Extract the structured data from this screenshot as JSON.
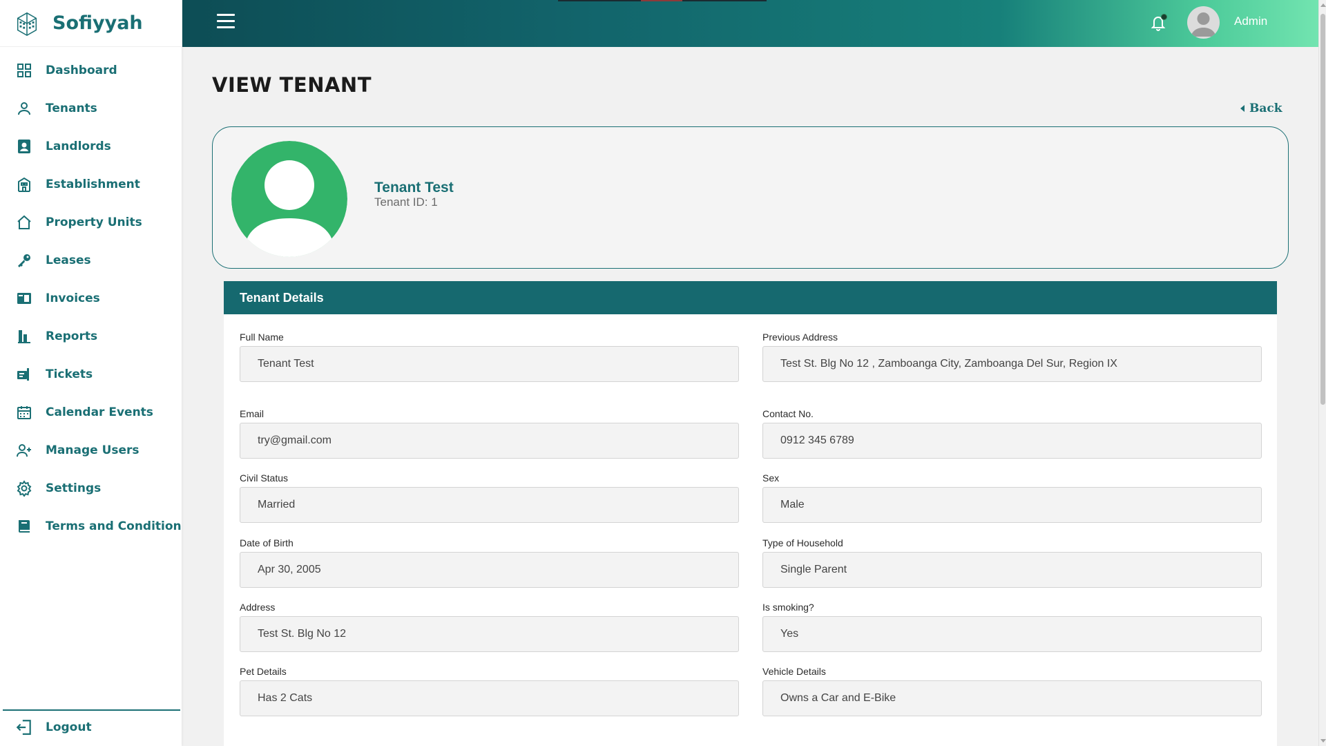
{
  "app": {
    "name": "Sofiyyah"
  },
  "sidebar": {
    "items": [
      {
        "label": "Dashboard",
        "icon": "dashboard-grid-icon"
      },
      {
        "label": "Tenants",
        "icon": "user-outline-icon"
      },
      {
        "label": "Landlords",
        "icon": "id-badge-icon"
      },
      {
        "label": "Establishment",
        "icon": "building-icon"
      },
      {
        "label": "Property Units",
        "icon": "home-icon"
      },
      {
        "label": "Leases",
        "icon": "key-icon"
      },
      {
        "label": "Invoices",
        "icon": "invoice-icon"
      },
      {
        "label": "Reports",
        "icon": "bar-chart-icon"
      },
      {
        "label": "Tickets",
        "icon": "ticket-icon"
      },
      {
        "label": "Calendar Events",
        "icon": "calendar-icon"
      },
      {
        "label": "Manage Users",
        "icon": "user-plus-icon"
      },
      {
        "label": "Settings",
        "icon": "gear-icon"
      },
      {
        "label": "Terms and Condition",
        "icon": "book-icon"
      }
    ],
    "logout_label": "Logout"
  },
  "topbar": {
    "user_label": "Admin"
  },
  "page": {
    "title": "VIEW TENANT",
    "back_label": "Back"
  },
  "profile": {
    "name": "Tenant Test",
    "tenant_id": "Tenant ID: 1"
  },
  "details": {
    "heading": "Tenant Details",
    "full_name": {
      "label": "Full Name",
      "value": "Tenant Test"
    },
    "previous_address": {
      "label": "Previous Address",
      "value": "Test St. Blg No 12 , Zamboanga City, Zamboanga Del Sur, Region IX"
    },
    "email": {
      "label": "Email",
      "value": "try@gmail.com"
    },
    "contact": {
      "label": "Contact No.",
      "value": "0912 345 6789"
    },
    "civil_status": {
      "label": "Civil Status",
      "value": "Married"
    },
    "sex": {
      "label": "Sex",
      "value": "Male"
    },
    "dob": {
      "label": "Date of Birth",
      "value": "Apr 30, 2005"
    },
    "household": {
      "label": "Type of Household",
      "value": "Single Parent"
    },
    "address": {
      "label": "Address",
      "value": "Test St. Blg No 12"
    },
    "smoking": {
      "label": "Is smoking?",
      "value": "Yes"
    },
    "pets": {
      "label": "Pet Details",
      "value": "Has 2 Cats"
    },
    "vehicle": {
      "label": "Vehicle Details",
      "value": "Owns a Car and E-Bike"
    }
  },
  "colors": {
    "primary": "#1a6f74",
    "header": "#16696f",
    "avatar": "#33b46a"
  }
}
